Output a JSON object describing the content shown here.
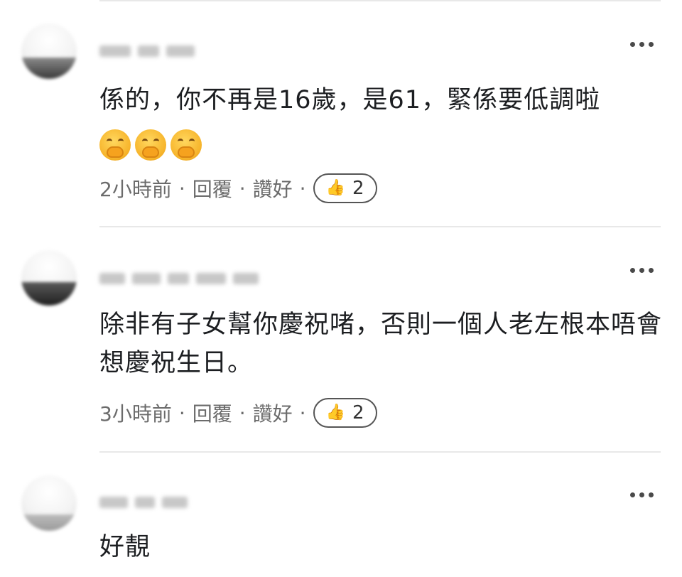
{
  "icons": {
    "more": "more-dots-icon",
    "like": "thumbs-up-icon",
    "emoji": "hand-over-mouth-emoji"
  },
  "colors": {
    "text": "#1c1e21",
    "meta": "#6b6b6b",
    "divider": "#e8e8e8"
  },
  "comments": [
    {
      "text": "係的，你不再是16歲，是61，緊係要低調啦",
      "emoji_count": 3,
      "time": "2小時前",
      "reply_label": "回覆",
      "like_label": "讚好",
      "like_count": "2"
    },
    {
      "text": "除非有子女幫你慶祝啫，否則一個人老左根本唔會想慶祝生日。",
      "time": "3小時前",
      "reply_label": "回覆",
      "like_label": "讚好",
      "like_count": "2"
    },
    {
      "text": "好靚"
    }
  ]
}
